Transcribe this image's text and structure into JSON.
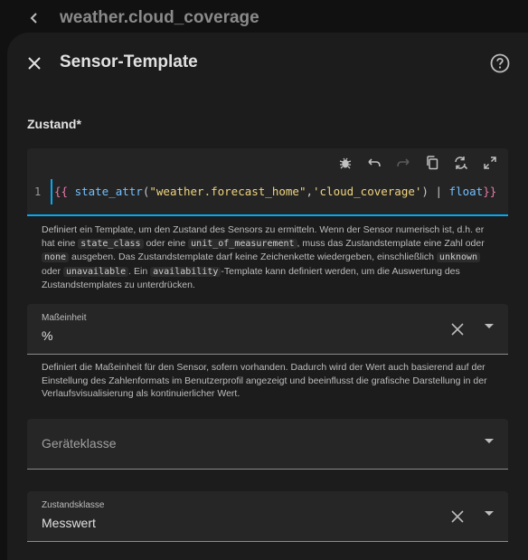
{
  "topbar": {
    "title": "weather.cloud_coverage"
  },
  "dialog": {
    "title": "Sensor-Template"
  },
  "state": {
    "label": "Zustand*",
    "line_number": "1",
    "code_tokens": [
      {
        "t": "{{ ",
        "c": "brace"
      },
      {
        "t": "state_attr",
        "c": "fn"
      },
      {
        "t": "(",
        "c": "punct"
      },
      {
        "t": "\"weather.forecast_home\"",
        "c": "str"
      },
      {
        "t": ",",
        "c": "punct"
      },
      {
        "t": "'cloud_coverage'",
        "c": "str"
      },
      {
        "t": ") ",
        "c": "punct"
      },
      {
        "t": "| ",
        "c": "punct"
      },
      {
        "t": "float",
        "c": "filt"
      },
      {
        "t": "}}",
        "c": "brace"
      }
    ],
    "helper_parts": [
      "Definiert ein Template, um den Zustand des Sensors zu ermitteln. Wenn der Sensor numerisch ist, d.h. er hat eine ",
      "state_class",
      " oder eine ",
      "unit_of_measurement",
      ", muss das Zustandstemplate eine Zahl oder ",
      "none",
      " ausgeben. Das Zustandstemplate darf keine Zeichenkette wiedergeben, einschließlich ",
      "unknown",
      " oder ",
      "unavailable",
      ". Ein ",
      "availability",
      "-Template kann definiert werden, um die Auswertung des Zustandstemplates zu unterdrücken."
    ]
  },
  "unit_field": {
    "label": "Maßeinheit",
    "value": "%",
    "helper": "Definiert die Maßeinheit für den Sensor, sofern vorhanden. Dadurch wird der Wert auch basierend auf der Einstellung des Zahlenformats im Benutzerprofil angezeigt und beeinflusst die grafische Darstellung in der Verlaufsvisualisierung als kontinuierlicher Wert."
  },
  "device_class_field": {
    "placeholder": "Geräteklasse"
  },
  "state_class_field": {
    "label": "Zustandsklasse",
    "value": "Messwert"
  },
  "colors": {
    "accent": "#03a9f4",
    "background": "#111111",
    "dialog": "#1c1c1c",
    "field": "#262626"
  }
}
